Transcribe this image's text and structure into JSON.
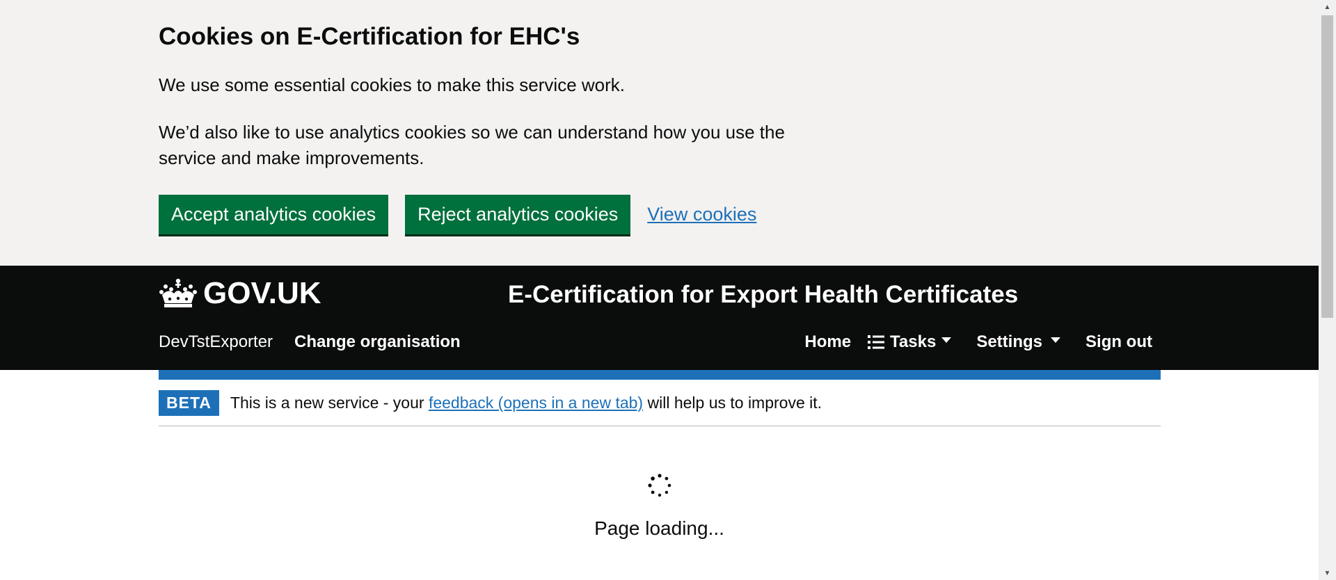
{
  "cookie_banner": {
    "title": "Cookies on E-Certification for EHC's",
    "paragraph1": "We use some essential cookies to make this service work.",
    "paragraph2": "We’d also like to use analytics cookies so we can understand how you use the service and make improvements.",
    "accept_label": "Accept analytics cookies",
    "reject_label": "Reject analytics cookies",
    "view_label": "View cookies"
  },
  "header": {
    "logo_text": "GOV.UK",
    "service_name": "E-Certification for Export Health Certificates",
    "organisation": "DevTstExporter",
    "change_org_label": "Change organisation",
    "nav": {
      "home": "Home",
      "tasks": "Tasks",
      "settings": "Settings",
      "sign_out": "Sign out"
    }
  },
  "phase_banner": {
    "tag": "BETA",
    "text_before": "This is a new service - your",
    "link_text": "feedback (opens in a new tab)",
    "text_after": "will help us to improve it."
  },
  "loading": {
    "text": "Page loading..."
  },
  "colors": {
    "header_bg": "#0b0c0c",
    "cookie_bg": "#f3f2f1",
    "button_green": "#00703c",
    "link_blue": "#1d70b8",
    "brand_blue": "#1d70b8"
  }
}
